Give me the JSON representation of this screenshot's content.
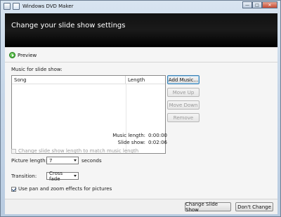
{
  "window": {
    "title": "Windows DVD Maker",
    "controls": [
      "minimize",
      "maximize",
      "close"
    ]
  },
  "header": {
    "title": "Change your slide show settings"
  },
  "preview": {
    "label": "Preview",
    "icon": "play-icon"
  },
  "music": {
    "label": "Music for slide show:",
    "columns": [
      "Song",
      "Length"
    ],
    "rows": []
  },
  "buttons": {
    "add_music": "Add Music...",
    "move_up": "Move Up",
    "move_down": "Move Down",
    "remove": "Remove"
  },
  "stats": {
    "music_length_label": "Music length:",
    "music_length_value": "0:00:00",
    "slide_show_label": "Slide show:",
    "slide_show_value": "0:02:06"
  },
  "options": {
    "match_music_label": "Change slide show length to match music length",
    "match_music_checked": false,
    "match_music_enabled": false,
    "picture_length_label": "Picture length:",
    "picture_length_value": "7",
    "picture_length_unit": "seconds",
    "transition_label": "Transition:",
    "transition_value": "Cross fade",
    "pan_zoom_label": "Use pan and zoom effects for pictures",
    "pan_zoom_checked": true
  },
  "footer": {
    "change_button": "Change Slide Show",
    "cancel_button": "Don't Change"
  }
}
